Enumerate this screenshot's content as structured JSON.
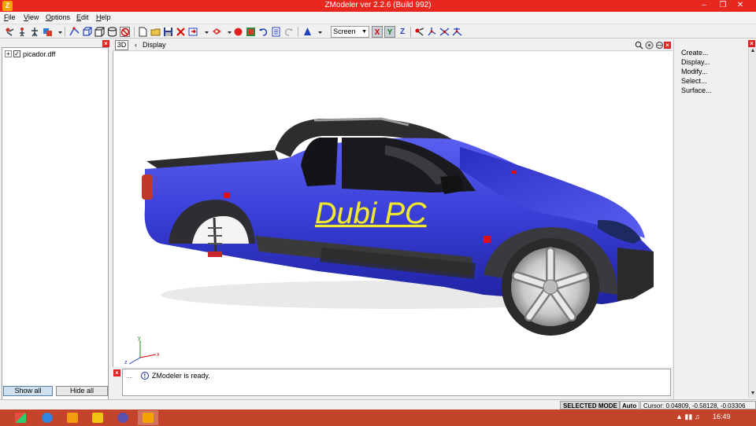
{
  "window": {
    "title": "ZModeler ver 2.2.6 (Build 992)",
    "app_icon_letter": "Z",
    "controls": [
      "minimize",
      "restore",
      "close"
    ]
  },
  "menu": [
    "File",
    "View",
    "Options",
    "Edit",
    "Help"
  ],
  "toolbar": {
    "view_select": "Screen",
    "axes": [
      "X",
      "Y",
      "Z"
    ],
    "icons": [
      "select-icon",
      "hierarchy-icon",
      "move-icon",
      "material-icon",
      "dropdown-icon",
      "create-vertex-icon",
      "box-icon",
      "cube-icon",
      "cylinder-icon",
      "no-select-icon",
      "new-file-icon",
      "open-file-icon",
      "save-file-icon",
      "delete-icon",
      "import-icon",
      "dropdown-icon",
      "render-icon",
      "dropdown-icon",
      "record-icon",
      "texture-icon",
      "undo-icon",
      "properties-icon",
      "redo-icon",
      "cone-icon",
      "dropdown-icon",
      "transform-icon",
      "scale-axis-icon",
      "rotate-axis-icon",
      "pivot-icon"
    ]
  },
  "left_panel": {
    "tree": [
      {
        "label": "picador.dff",
        "checked": true,
        "expanded": false
      }
    ],
    "show_all_label": "Show all",
    "hide_all_label": "Hide all"
  },
  "viewport": {
    "mode_label": "3D",
    "title": "Display",
    "watermark": "Dubi PC",
    "axis_labels": [
      "y",
      "x",
      "z"
    ],
    "colors": {
      "body": "#3b3fd9",
      "watermark": "#f2ea32"
    }
  },
  "log": {
    "message": "ZModeler is ready."
  },
  "right_panel": {
    "commands": [
      "Create...",
      "Display...",
      "Modify...",
      "Select...",
      "Surface..."
    ]
  },
  "status": {
    "mode": "SELECTED MODE",
    "auto": "Auto",
    "cursor": "Cursor: 0.04809, -0.58128, -0.03306"
  },
  "taskbar": {
    "apps": [
      "windows-logo-icon",
      "ie-icon",
      "media-player-icon",
      "explorer-icon",
      "browser-icon",
      "zmodeler-icon"
    ],
    "clock": "16:49"
  }
}
